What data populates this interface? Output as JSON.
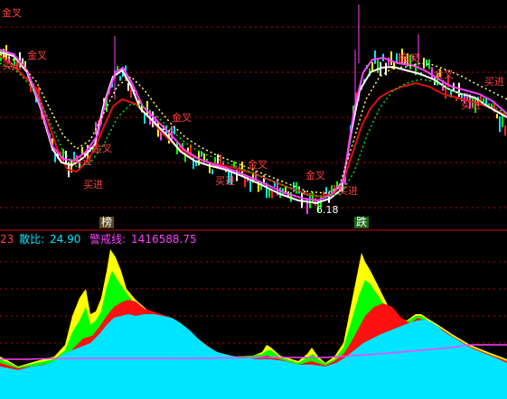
{
  "header": {
    "prefix": "23",
    "sanbi_label": "散比:",
    "sanbi_value": "24.90",
    "jingjie_label": "警戒线:",
    "jingjie_value": "1416588.75"
  },
  "markers": {
    "bang": "榜",
    "die": "跌",
    "low_price": "6.18"
  },
  "signals": {
    "golden_cross": "金叉",
    "buy": "买进"
  },
  "colors": {
    "background": "#000000",
    "separator": "#cc0000",
    "grid": "#cc0000",
    "white_line": "#ffffff",
    "magenta_line": "#ff40ff",
    "red_line": "#e01010",
    "yellow_dots": "#ffff60",
    "green_dots": "#00e000",
    "cyan_area": "#00e5ff",
    "red_area": "#ff1010",
    "green_area": "#00ff00",
    "yellow_area": "#ffff00",
    "warning_line": "#ff40ff",
    "header_label": "#00e5ff",
    "header_value": "#ff40ff",
    "header_prefix": "#ff4040"
  }
}
